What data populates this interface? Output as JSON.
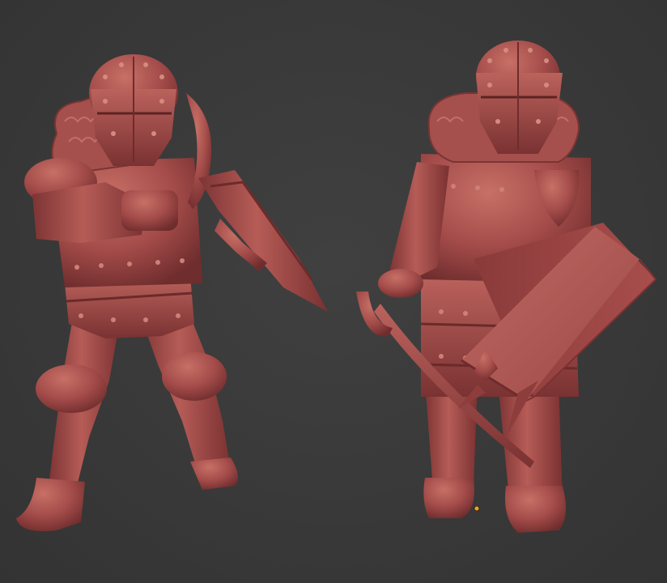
{
  "scene": {
    "background_color": "#3a3a3a",
    "model_color": "#a85050",
    "highlight_color": "#c46a62",
    "shadow_color": "#6e2c2c",
    "pivot_color": "#f0a030"
  },
  "models": [
    {
      "name": "crossbow-soldier"
    },
    {
      "name": "shield-soldier"
    }
  ]
}
